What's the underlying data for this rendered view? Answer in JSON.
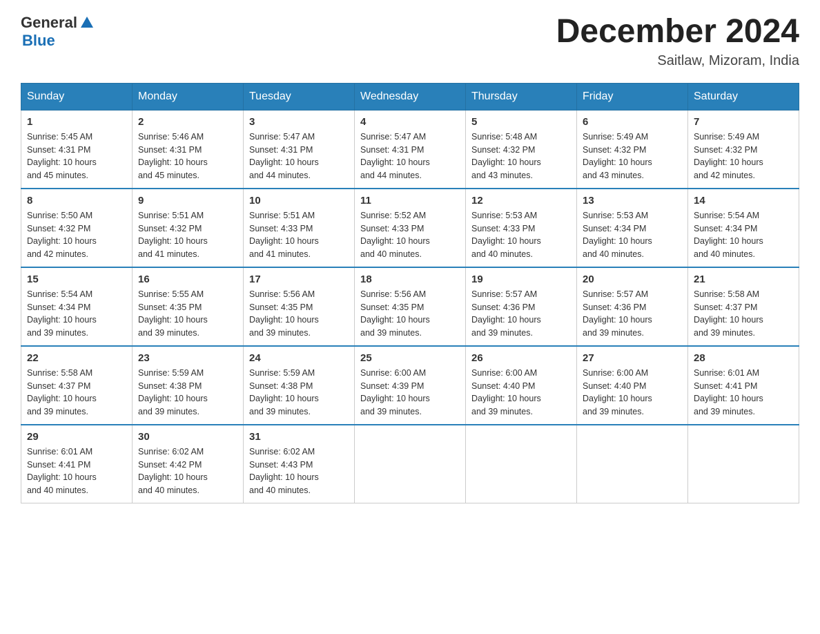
{
  "header": {
    "logo_general": "General",
    "logo_blue": "Blue",
    "month_title": "December 2024",
    "location": "Saitlaw, Mizoram, India"
  },
  "days_of_week": [
    "Sunday",
    "Monday",
    "Tuesday",
    "Wednesday",
    "Thursday",
    "Friday",
    "Saturday"
  ],
  "weeks": [
    [
      {
        "day": "1",
        "sunrise": "5:45 AM",
        "sunset": "4:31 PM",
        "daylight": "10 hours and 45 minutes."
      },
      {
        "day": "2",
        "sunrise": "5:46 AM",
        "sunset": "4:31 PM",
        "daylight": "10 hours and 45 minutes."
      },
      {
        "day": "3",
        "sunrise": "5:47 AM",
        "sunset": "4:31 PM",
        "daylight": "10 hours and 44 minutes."
      },
      {
        "day": "4",
        "sunrise": "5:47 AM",
        "sunset": "4:31 PM",
        "daylight": "10 hours and 44 minutes."
      },
      {
        "day": "5",
        "sunrise": "5:48 AM",
        "sunset": "4:32 PM",
        "daylight": "10 hours and 43 minutes."
      },
      {
        "day": "6",
        "sunrise": "5:49 AM",
        "sunset": "4:32 PM",
        "daylight": "10 hours and 43 minutes."
      },
      {
        "day": "7",
        "sunrise": "5:49 AM",
        "sunset": "4:32 PM",
        "daylight": "10 hours and 42 minutes."
      }
    ],
    [
      {
        "day": "8",
        "sunrise": "5:50 AM",
        "sunset": "4:32 PM",
        "daylight": "10 hours and 42 minutes."
      },
      {
        "day": "9",
        "sunrise": "5:51 AM",
        "sunset": "4:32 PM",
        "daylight": "10 hours and 41 minutes."
      },
      {
        "day": "10",
        "sunrise": "5:51 AM",
        "sunset": "4:33 PM",
        "daylight": "10 hours and 41 minutes."
      },
      {
        "day": "11",
        "sunrise": "5:52 AM",
        "sunset": "4:33 PM",
        "daylight": "10 hours and 40 minutes."
      },
      {
        "day": "12",
        "sunrise": "5:53 AM",
        "sunset": "4:33 PM",
        "daylight": "10 hours and 40 minutes."
      },
      {
        "day": "13",
        "sunrise": "5:53 AM",
        "sunset": "4:34 PM",
        "daylight": "10 hours and 40 minutes."
      },
      {
        "day": "14",
        "sunrise": "5:54 AM",
        "sunset": "4:34 PM",
        "daylight": "10 hours and 40 minutes."
      }
    ],
    [
      {
        "day": "15",
        "sunrise": "5:54 AM",
        "sunset": "4:34 PM",
        "daylight": "10 hours and 39 minutes."
      },
      {
        "day": "16",
        "sunrise": "5:55 AM",
        "sunset": "4:35 PM",
        "daylight": "10 hours and 39 minutes."
      },
      {
        "day": "17",
        "sunrise": "5:56 AM",
        "sunset": "4:35 PM",
        "daylight": "10 hours and 39 minutes."
      },
      {
        "day": "18",
        "sunrise": "5:56 AM",
        "sunset": "4:35 PM",
        "daylight": "10 hours and 39 minutes."
      },
      {
        "day": "19",
        "sunrise": "5:57 AM",
        "sunset": "4:36 PM",
        "daylight": "10 hours and 39 minutes."
      },
      {
        "day": "20",
        "sunrise": "5:57 AM",
        "sunset": "4:36 PM",
        "daylight": "10 hours and 39 minutes."
      },
      {
        "day": "21",
        "sunrise": "5:58 AM",
        "sunset": "4:37 PM",
        "daylight": "10 hours and 39 minutes."
      }
    ],
    [
      {
        "day": "22",
        "sunrise": "5:58 AM",
        "sunset": "4:37 PM",
        "daylight": "10 hours and 39 minutes."
      },
      {
        "day": "23",
        "sunrise": "5:59 AM",
        "sunset": "4:38 PM",
        "daylight": "10 hours and 39 minutes."
      },
      {
        "day": "24",
        "sunrise": "5:59 AM",
        "sunset": "4:38 PM",
        "daylight": "10 hours and 39 minutes."
      },
      {
        "day": "25",
        "sunrise": "6:00 AM",
        "sunset": "4:39 PM",
        "daylight": "10 hours and 39 minutes."
      },
      {
        "day": "26",
        "sunrise": "6:00 AM",
        "sunset": "4:40 PM",
        "daylight": "10 hours and 39 minutes."
      },
      {
        "day": "27",
        "sunrise": "6:00 AM",
        "sunset": "4:40 PM",
        "daylight": "10 hours and 39 minutes."
      },
      {
        "day": "28",
        "sunrise": "6:01 AM",
        "sunset": "4:41 PM",
        "daylight": "10 hours and 39 minutes."
      }
    ],
    [
      {
        "day": "29",
        "sunrise": "6:01 AM",
        "sunset": "4:41 PM",
        "daylight": "10 hours and 40 minutes."
      },
      {
        "day": "30",
        "sunrise": "6:02 AM",
        "sunset": "4:42 PM",
        "daylight": "10 hours and 40 minutes."
      },
      {
        "day": "31",
        "sunrise": "6:02 AM",
        "sunset": "4:43 PM",
        "daylight": "10 hours and 40 minutes."
      },
      null,
      null,
      null,
      null
    ]
  ],
  "labels": {
    "sunrise": "Sunrise:",
    "sunset": "Sunset:",
    "daylight": "Daylight:"
  }
}
